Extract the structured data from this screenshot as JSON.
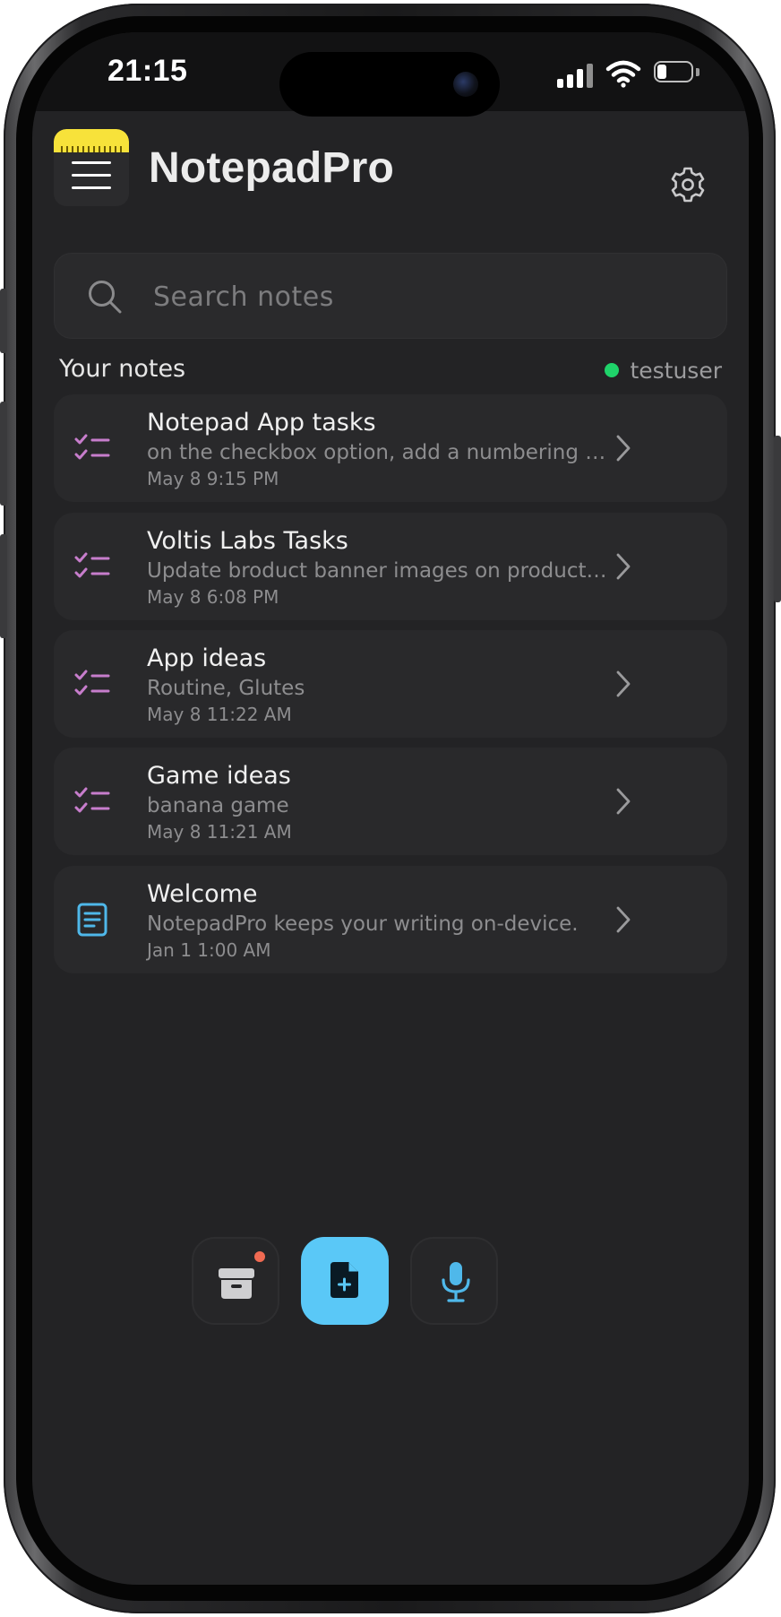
{
  "status_bar": {
    "time": "21:15"
  },
  "header": {
    "title": "NotepadPro",
    "menu_icon": "hamburger-menu-icon",
    "settings_icon": "gear-icon"
  },
  "search": {
    "placeholder": "Search notes",
    "value": ""
  },
  "notes_section": {
    "label": "Your notes",
    "user": "testuser",
    "user_status_color": "#1fd36a"
  },
  "notes": [
    {
      "icon": "checklist-icon",
      "title": "Notepad App tasks",
      "preview": "on the checkbox option, add a numbering and …",
      "date": "May 8 9:15 PM"
    },
    {
      "icon": "checklist-icon",
      "title": "Voltis Labs Tasks",
      "preview": "Update broduct banner images on product -p…",
      "date": "May 8 6:08 PM"
    },
    {
      "icon": "checklist-icon",
      "title": "App ideas",
      "preview": "Routine, Glutes",
      "date": "May 8 11:22 AM"
    },
    {
      "icon": "checklist-icon",
      "title": "Game ideas",
      "preview": "banana game",
      "date": "May 8 11:21 AM"
    },
    {
      "icon": "document-icon",
      "title": "Welcome",
      "preview": "NotepadPro keeps your writing on-device.",
      "date": "Jan 1 1:00 AM"
    }
  ],
  "bottom_bar": {
    "archive_icon": "archive-box-icon",
    "new_note_icon": "new-document-icon",
    "voice_icon": "microphone-icon"
  },
  "colors": {
    "background": "#232325",
    "card": "#29292b",
    "accent": "#5ac8f7",
    "checklist_icon": "#c77dcc",
    "document_icon": "#4fb8ea",
    "badge": "#f06a52",
    "menu_ruler": "#f7e23a"
  }
}
